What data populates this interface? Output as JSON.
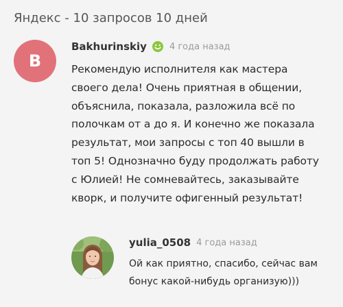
{
  "page": {
    "title": "Яндекс - 10 запросов 10 дней"
  },
  "review": {
    "avatar_letter": "B",
    "avatar_color": "#e2727a",
    "username": "Bakhurinskiy",
    "status_icon": "smile-icon",
    "time": "4 года назад",
    "text_lines": [
      "Рекомендую исполнителя как мастера",
      "своего дела! Очень приятная в общении,",
      "объяснила, показала, разложила всё по",
      "полочкам от а до я. И конечно же показала",
      "результат, мои запросы с топ 40 вышли в",
      "топ 5! Однозначно буду продолжать работу",
      "с Юлией! Не сомневайтесь, заказывайте",
      "кворк, и получите офигенный результат!"
    ]
  },
  "reply": {
    "username": "yulia_0508",
    "time": "4 года назад",
    "text_lines": [
      "Ой как приятно, спасибо, сейчас вам",
      "бонус какой-нибудь организую)))"
    ]
  }
}
